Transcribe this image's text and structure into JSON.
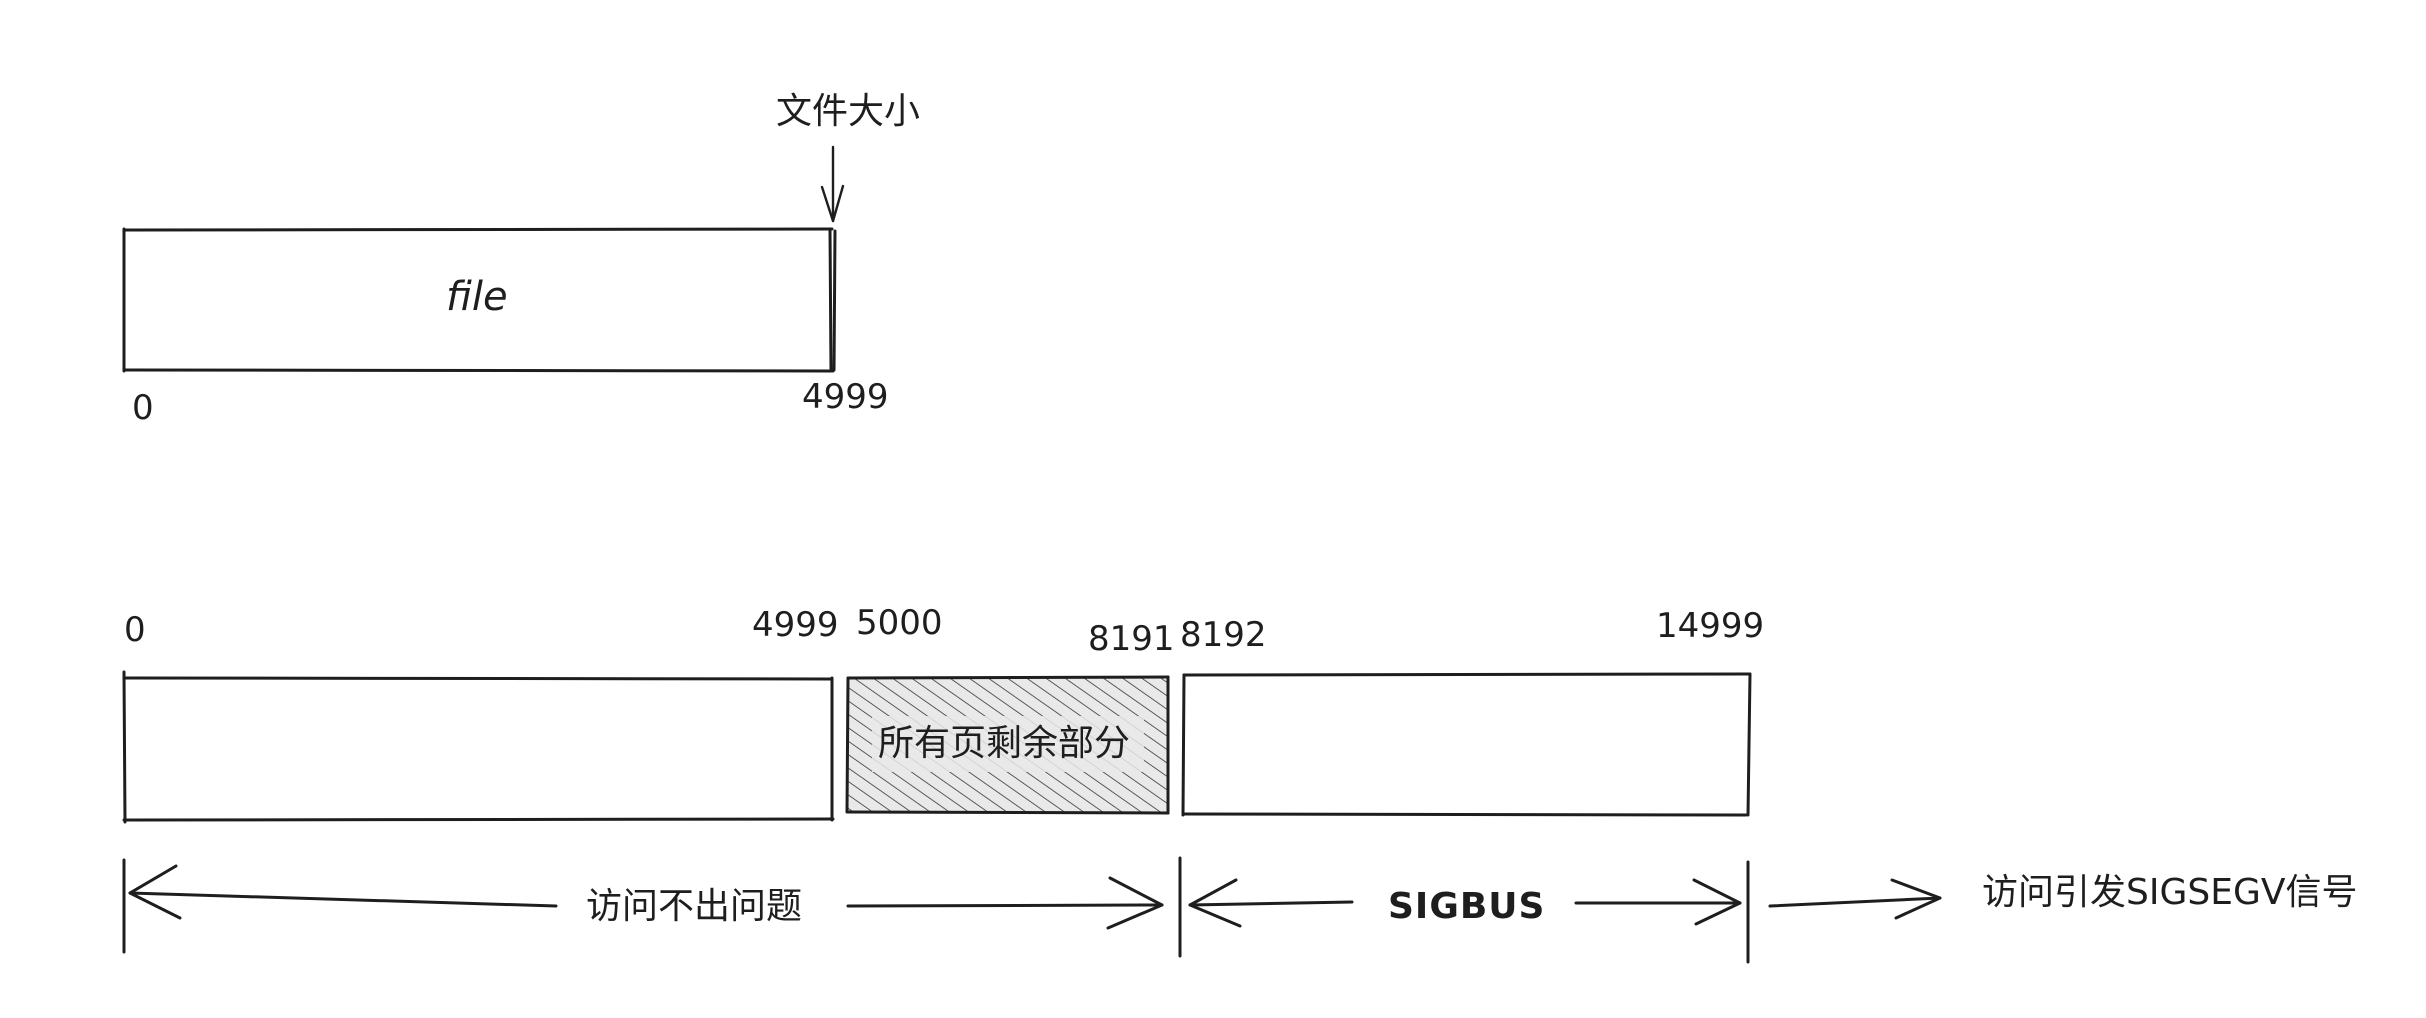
{
  "top": {
    "file_size_label": "文件大小",
    "file_label": "file",
    "start_offset": "0",
    "end_offset": "4999"
  },
  "bottom": {
    "offsets": {
      "start": "0",
      "file_end": "4999",
      "page_rest_start": "5000",
      "page_end": "8191",
      "next_page_start": "8192",
      "mapping_end": "14999"
    },
    "page_remainder_label": "所有页剩余部分",
    "ok_access_label": "访问不出问题",
    "sigbus_label": "SIGBUS",
    "sigsegv_label": "访问引发SIGSEGV信号"
  },
  "colors": {
    "stroke": "#1e1e1e",
    "hatch": "#1e1e1e",
    "hatch_bg": "#e9e9e9",
    "background": "#ffffff"
  }
}
